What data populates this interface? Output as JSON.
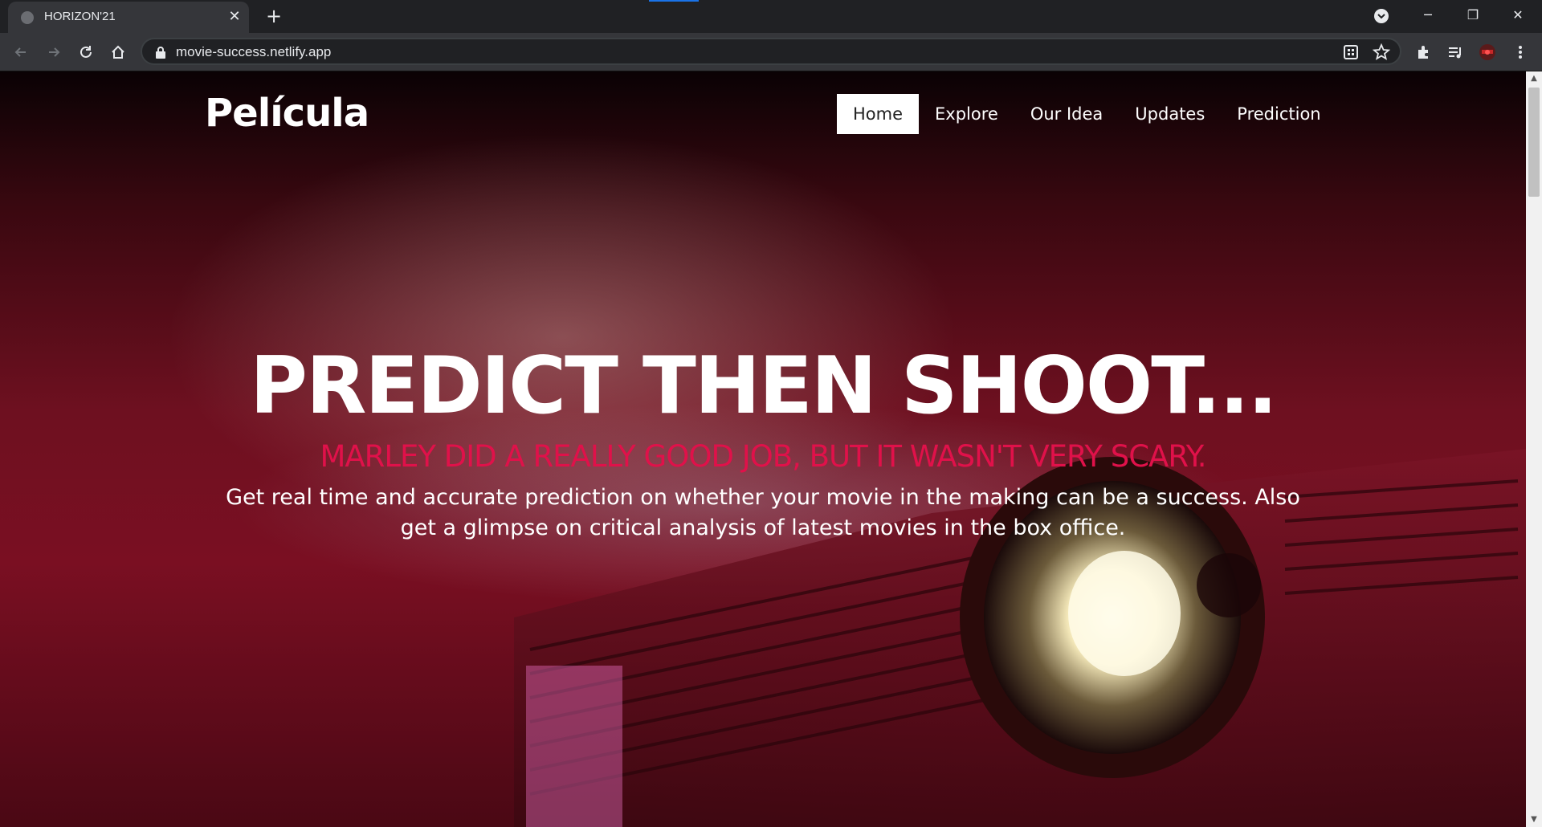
{
  "browser": {
    "tab_title": "HORIZON'21",
    "tab_close": "✕",
    "new_tab": "+",
    "url": "movie-success.netlify.app",
    "window_minimize": "─",
    "window_restore": "❐",
    "window_close": "✕"
  },
  "site": {
    "logo": "Película",
    "nav": [
      "Home",
      "Explore",
      "Our Idea",
      "Updates",
      "Prediction"
    ],
    "active_nav": "Home",
    "hero_title": "PREDICT THEN SHOOT...",
    "hero_quote": "MARLEY DID A REALLY GOOD JOB, BUT IT WASN'T VERY SCARY.",
    "hero_description": "Get real time and accurate prediction on whether your movie in the making can be a success. Also get a glimpse on critical analysis of latest movies in the box office."
  },
  "colors": {
    "accent_quote": "#e0114a",
    "chrome_dark": "#202124",
    "chrome_toolbar": "#35363a"
  }
}
